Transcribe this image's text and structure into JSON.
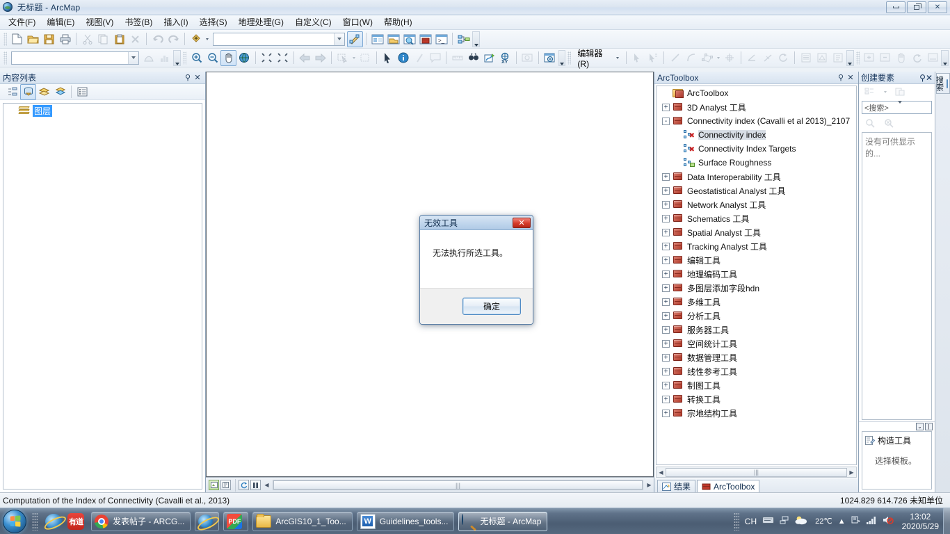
{
  "window": {
    "title": "无标题 - ArcMap",
    "app_icon": "globe-icon",
    "minimize": "minimize-icon",
    "restore": "restore-icon",
    "close": "close-icon"
  },
  "menu": {
    "items": [
      {
        "label": "文件(F)"
      },
      {
        "label": "编辑(E)"
      },
      {
        "label": "视图(V)"
      },
      {
        "label": "书签(B)"
      },
      {
        "label": "插入(I)"
      },
      {
        "label": "选择(S)"
      },
      {
        "label": "地理处理(G)"
      },
      {
        "label": "自定义(C)"
      },
      {
        "label": "窗口(W)"
      },
      {
        "label": "帮助(H)"
      }
    ]
  },
  "toolbar_standard": {
    "buttons": [
      {
        "name": "new-document-icon"
      },
      {
        "name": "open-document-icon"
      },
      {
        "name": "save-icon"
      },
      {
        "name": "print-icon"
      },
      {
        "name": "cut-icon"
      },
      {
        "name": "copy-icon"
      },
      {
        "name": "paste-icon"
      },
      {
        "name": "delete-icon"
      },
      {
        "name": "undo-icon"
      },
      {
        "name": "redo-icon"
      },
      {
        "name": "add-data-icon"
      }
    ],
    "scale_value": "",
    "scale_placeholder": "",
    "right_buttons": [
      {
        "name": "editor-toolbar-icon"
      },
      {
        "name": "table-of-contents-icon"
      },
      {
        "name": "catalog-icon"
      },
      {
        "name": "search-window-icon"
      },
      {
        "name": "arctoolbox-icon"
      },
      {
        "name": "python-window-icon"
      },
      {
        "name": "model-builder-icon"
      }
    ]
  },
  "toolbar_tools": {
    "layer_combo_value": "",
    "buttons": [
      {
        "name": "zoom-in-icon"
      },
      {
        "name": "zoom-out-icon"
      },
      {
        "name": "pan-icon"
      },
      {
        "name": "full-extent-icon"
      },
      {
        "name": "fixed-zoom-in-icon"
      },
      {
        "name": "fixed-zoom-out-icon"
      },
      {
        "name": "go-back-extent-icon"
      },
      {
        "name": "go-next-extent-icon"
      },
      {
        "name": "select-features-icon"
      },
      {
        "name": "clear-selection-icon"
      },
      {
        "name": "select-elements-icon"
      },
      {
        "name": "identify-icon"
      },
      {
        "name": "hyperlink-icon"
      },
      {
        "name": "html-popup-icon"
      },
      {
        "name": "measure-icon"
      },
      {
        "name": "find-icon"
      },
      {
        "name": "find-route-icon"
      },
      {
        "name": "go-to-xy-icon"
      },
      {
        "name": "time-slider-icon"
      },
      {
        "name": "create-viewer-window-icon"
      }
    ]
  },
  "toolbar_editor": {
    "menu_label": "编辑器(R)",
    "buttons": [
      {
        "name": "edit-tool-icon"
      },
      {
        "name": "edit-annotation-icon"
      },
      {
        "name": "straight-segment-icon"
      },
      {
        "name": "endpoint-arc-icon"
      },
      {
        "name": "edit-vertices-icon"
      },
      {
        "name": "reshape-feature-icon"
      },
      {
        "name": "cut-polygons-icon"
      },
      {
        "name": "split-icon"
      },
      {
        "name": "rotate-icon"
      },
      {
        "name": "attributes-icon"
      },
      {
        "name": "sketch-properties-icon"
      },
      {
        "name": "create-features-icon"
      }
    ]
  },
  "toolbar_right_extra": {
    "buttons": [
      {
        "name": "zoom-in-data-icon"
      },
      {
        "name": "zoom-out-data-icon"
      },
      {
        "name": "pan-data-icon"
      },
      {
        "name": "refresh-data-icon"
      },
      {
        "name": "data-view-icon"
      }
    ]
  },
  "toc_panel": {
    "title": "内容列表",
    "pin": "pin-icon",
    "close": "close-icon",
    "tool_buttons": [
      {
        "name": "list-by-drawing-order-icon"
      },
      {
        "name": "list-by-source-icon"
      },
      {
        "name": "list-by-visibility-icon"
      },
      {
        "name": "list-by-selection-icon"
      },
      {
        "name": "options-icon"
      }
    ],
    "tree": [
      {
        "label": "图层",
        "selected": true,
        "icon": "layers-icon"
      }
    ]
  },
  "map_view": {
    "bottom_buttons": [
      {
        "name": "data-view-icon"
      },
      {
        "name": "layout-view-icon"
      },
      {
        "name": "refresh-view-icon"
      },
      {
        "name": "pause-drawing-icon"
      }
    ]
  },
  "arctoolbox_panel": {
    "title": "ArcToolbox",
    "pin": "pin-icon",
    "close": "close-icon",
    "tree": [
      {
        "label": "ArcToolbox",
        "level": 0,
        "icon": "arctoolbox-root-icon",
        "expander": ""
      },
      {
        "label": "3D Analyst 工具",
        "level": 1,
        "icon": "toolbox-icon",
        "expander": "+"
      },
      {
        "label": "Connectivity index (Cavalli et al 2013)_2107",
        "level": 1,
        "icon": "toolbox-icon",
        "expander": "-"
      },
      {
        "label": "Connectivity index",
        "level": 2,
        "icon": "script-tool-icon",
        "expander": "",
        "highlighted": true
      },
      {
        "label": "Connectivity Index Targets",
        "level": 2,
        "icon": "script-tool-icon",
        "expander": ""
      },
      {
        "label": "Surface Roughness",
        "level": 2,
        "icon": "model-tool-icon",
        "expander": ""
      },
      {
        "label": "Data Interoperability 工具",
        "level": 1,
        "icon": "toolbox-icon",
        "expander": "+"
      },
      {
        "label": "Geostatistical Analyst 工具",
        "level": 1,
        "icon": "toolbox-icon",
        "expander": "+"
      },
      {
        "label": "Network Analyst 工具",
        "level": 1,
        "icon": "toolbox-icon",
        "expander": "+"
      },
      {
        "label": "Schematics 工具",
        "level": 1,
        "icon": "toolbox-icon",
        "expander": "+"
      },
      {
        "label": "Spatial Analyst 工具",
        "level": 1,
        "icon": "toolbox-icon",
        "expander": "+"
      },
      {
        "label": "Tracking Analyst 工具",
        "level": 1,
        "icon": "toolbox-icon",
        "expander": "+"
      },
      {
        "label": "编辑工具",
        "level": 1,
        "icon": "toolbox-icon",
        "expander": "+"
      },
      {
        "label": "地理编码工具",
        "level": 1,
        "icon": "toolbox-icon",
        "expander": "+"
      },
      {
        "label": "多图层添加字段hdn",
        "level": 1,
        "icon": "toolbox-icon",
        "expander": "+"
      },
      {
        "label": "多维工具",
        "level": 1,
        "icon": "toolbox-icon",
        "expander": "+"
      },
      {
        "label": "分析工具",
        "level": 1,
        "icon": "toolbox-icon",
        "expander": "+"
      },
      {
        "label": "服务器工具",
        "level": 1,
        "icon": "toolbox-icon",
        "expander": "+"
      },
      {
        "label": "空间统计工具",
        "level": 1,
        "icon": "toolbox-icon",
        "expander": "+"
      },
      {
        "label": "数据管理工具",
        "level": 1,
        "icon": "toolbox-icon",
        "expander": "+"
      },
      {
        "label": "线性参考工具",
        "level": 1,
        "icon": "toolbox-icon",
        "expander": "+"
      },
      {
        "label": "制图工具",
        "level": 1,
        "icon": "toolbox-icon",
        "expander": "+"
      },
      {
        "label": "转换工具",
        "level": 1,
        "icon": "toolbox-icon",
        "expander": "+"
      },
      {
        "label": "宗地结构工具",
        "level": 1,
        "icon": "toolbox-icon",
        "expander": "+"
      }
    ],
    "tabs": [
      {
        "label": "结果",
        "icon": "results-icon",
        "selected": false
      },
      {
        "label": "ArcToolbox",
        "icon": "arctoolbox-icon",
        "selected": true
      }
    ]
  },
  "create_features_panel": {
    "title": "创建要素",
    "pin": "pin-icon",
    "close": "close-icon",
    "tool_buttons": [
      {
        "name": "organize-templates-icon"
      },
      {
        "name": "create-new-template-icon"
      }
    ],
    "search_placeholder": "<搜索>",
    "search_value": "<搜索>",
    "search_buttons": [
      {
        "name": "search-icon"
      },
      {
        "name": "clear-search-icon"
      }
    ],
    "empty_message": "没有可供显示的...",
    "divider_buttons": [
      {
        "name": "collapse-icon"
      },
      {
        "name": "split-pane-icon"
      }
    ],
    "construction_tools": {
      "title": "构造工具",
      "icon": "construction-tools-icon",
      "message": "选择模板。"
    }
  },
  "vertical_tab_strip": {
    "tabs": [
      {
        "label": "搜索",
        "icon": "search-window-icon"
      }
    ]
  },
  "dialog": {
    "title": "无效工具",
    "close_label": "✕",
    "message": "无法执行所选工具。",
    "ok_label": "确定"
  },
  "status_bar": {
    "message": "Computation of the Index of Connectivity (Cavalli et al., 2013)",
    "coordinates": "1024.829  614.726  未知单位"
  },
  "taskbar": {
    "start_label": "start-orb",
    "quick_launch": [
      {
        "name": "internet-explorer-icon",
        "label": "e"
      },
      {
        "name": "youdao-dict-icon",
        "label": "有道"
      }
    ],
    "items": [
      {
        "name": "chrome-task",
        "icon": "chrome-icon",
        "label": "发表帖子 - ARCG...",
        "active": false
      },
      {
        "name": "ie-task",
        "icon": "internet-explorer-icon",
        "label": "",
        "active": false
      },
      {
        "name": "pdf-task",
        "icon": "pdf-icon",
        "label": "PDF",
        "active": false
      },
      {
        "name": "folder-task",
        "icon": "folder-icon",
        "label": "ArcGIS10_1_Too...",
        "active": false
      },
      {
        "name": "word-task",
        "icon": "word-icon",
        "label": "Guidelines_tools...",
        "active": false
      },
      {
        "name": "arcmap-task",
        "icon": "arcmap-icon",
        "label": "无标题 - ArcMap",
        "active": true
      }
    ],
    "tray": {
      "input_method": "CH",
      "keyboard_icon": "keyboard-icon",
      "network_icon": "network-icon",
      "weather_icon": "weather-partly-cloudy-icon",
      "weather_temp": "22℃",
      "show_hidden_icon": "chevron-up-icon",
      "action_center_icon": "action-center-icon",
      "signal_icon": "signal-bars-icon",
      "volume_icon": "volume-muted-icon",
      "time": "13:02",
      "date": "2020/5/29"
    }
  }
}
